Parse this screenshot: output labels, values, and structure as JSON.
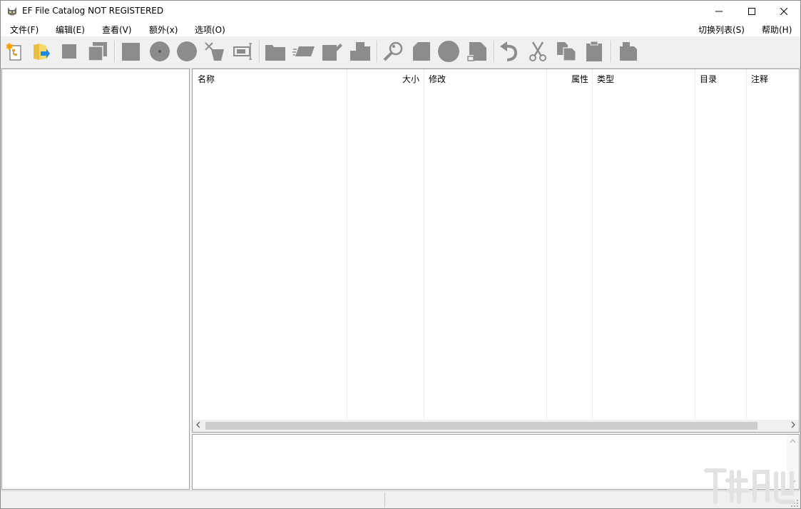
{
  "window": {
    "title": "EF File Catalog NOT REGISTERED",
    "app_icon": "cat-face-icon",
    "controls": [
      "minimize-icon",
      "maximize-icon",
      "close-icon"
    ]
  },
  "menu": {
    "file": "文件(F)",
    "edit": "编辑(E)",
    "view": "查看(V)",
    "extra": "额外(x)",
    "options": "选项(O)",
    "switch_list": "切换列表(S)",
    "help": "帮助(H)"
  },
  "toolbar": {
    "icons": [
      "new-catalog-icon",
      "open-catalog-icon",
      "save-icon",
      "save-all-icon",
      "add-disk-icon",
      "cd-icon",
      "disk-icon",
      "delete-disk-icon",
      "rename-disk-icon",
      "folder-icon",
      "drive-icon",
      "edit-item-icon",
      "move-item-icon",
      "search-icon",
      "document-icon",
      "circle-icon",
      "page-icon",
      "undo-icon",
      "cut-icon",
      "copy-icon",
      "paste-icon",
      "properties-icon"
    ]
  },
  "list": {
    "columns": [
      "名称",
      "大小",
      "修改",
      "属性",
      "类型",
      "目录",
      "注释"
    ],
    "rows": []
  },
  "scrollbar": {
    "left_arrow": "<",
    "right_arrow": ">",
    "up_arrow": "^",
    "down_arrow": "v"
  }
}
